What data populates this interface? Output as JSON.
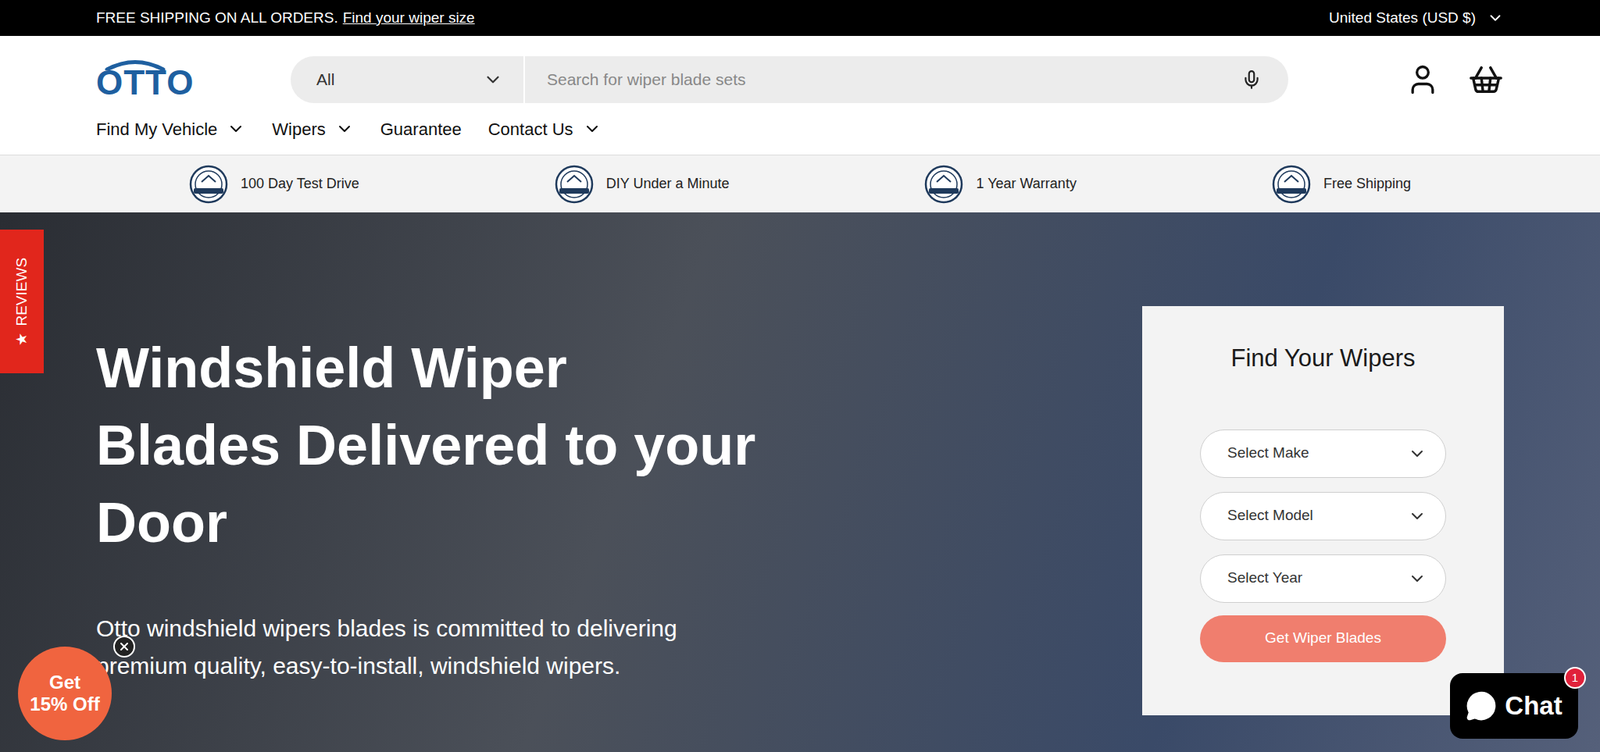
{
  "announcement": {
    "text": "FREE SHIPPING ON ALL ORDERS.",
    "link": "Find your wiper size"
  },
  "region": "United States (USD $)",
  "logo": "OTTO",
  "search": {
    "category": "All",
    "placeholder": "Search for wiper blade sets"
  },
  "nav": [
    {
      "label": "Find My Vehicle",
      "dropdown": true
    },
    {
      "label": "Wipers",
      "dropdown": true
    },
    {
      "label": "Guarantee",
      "dropdown": false
    },
    {
      "label": "Contact Us",
      "dropdown": true
    }
  ],
  "features": [
    {
      "label": "100 Day Test Drive"
    },
    {
      "label": "DIY Under a Minute"
    },
    {
      "label": "1 Year Warranty"
    },
    {
      "label": "Free Shipping"
    }
  ],
  "hero": {
    "title_lines": [
      "Windshield Wiper",
      "Blades Delivered to your",
      "Door"
    ],
    "subtitle_lines": [
      "Otto windshield wipers blades is committed to delivering",
      "premium quality, easy-to-install, windshield wipers."
    ]
  },
  "finder": {
    "title": "Find Your Wipers",
    "selects": [
      "Select Make",
      "Select Model",
      "Select Year"
    ],
    "button": "Get Wiper Blades"
  },
  "reviews_tab": {
    "star": "★",
    "label": "REVIEWS"
  },
  "promo": {
    "lines": [
      "Get",
      "15% Off"
    ]
  },
  "chat": {
    "label": "Chat",
    "badge": "1"
  }
}
